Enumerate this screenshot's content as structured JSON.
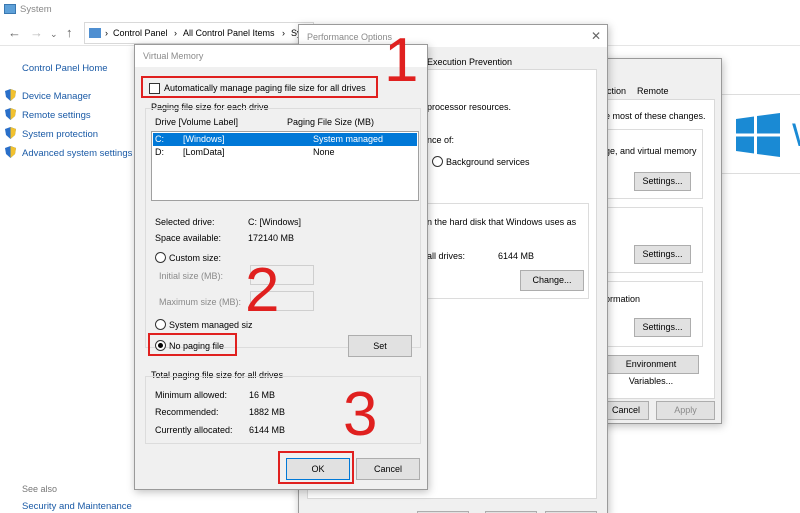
{
  "system_window": {
    "title": "System",
    "breadcrumb": [
      "Control Panel",
      "All Control Panel Items",
      "Sy"
    ],
    "sidebar": {
      "home": "Control Panel Home",
      "items": [
        "Device Manager",
        "Remote settings",
        "System protection",
        "Advanced system settings"
      ],
      "see_also": "See also",
      "security": "Security and Maintenance"
    }
  },
  "performance_options": {
    "title": "Performance Options",
    "tab": "Execution Prevention",
    "text_processor": "processor resources.",
    "text_perf_of": "nce of:",
    "radio_background": "Background services",
    "text_hard_disk": "n the hard disk that Windows uses as",
    "text_all_drives": "all drives:",
    "all_drives_value": "6144 MB",
    "change_button": "Change..."
  },
  "system_properties": {
    "tabs_visible": [
      "ction",
      "Remote"
    ],
    "text_most": "e most of these changes.",
    "text_virtual": "ge, and virtual memory",
    "settings_button": "Settings...",
    "text_formation": "ormation",
    "env_button": "Environment Variables...",
    "cancel_button": "Cancel",
    "apply_button": "Apply"
  },
  "windows_logo_text": "W",
  "virtual_memory": {
    "title": "Virtual Memory",
    "auto_manage_label": "Automatically manage paging file size for all drives",
    "auto_manage_checked": false,
    "group_label": "Paging file size for each drive",
    "columns": [
      "Drive  [Volume Label]",
      "Paging File Size (MB)"
    ],
    "drives": [
      {
        "drive": "C:",
        "label": "[Windows]",
        "size": "System managed",
        "selected": true
      },
      {
        "drive": "D:",
        "label": "[LomData]",
        "size": "None",
        "selected": false
      }
    ],
    "selected_drive_label": "Selected drive:",
    "selected_drive_value": "C:  [Windows]",
    "space_available_label": "Space available:",
    "space_available_value": "172140 MB",
    "custom_size_label": "Custom size:",
    "initial_size_label": "Initial size (MB):",
    "maximum_size_label": "Maximum size (MB):",
    "system_managed_label": "System managed siz",
    "no_paging_label": "No paging file",
    "set_button": "Set",
    "total_group_label": "Total paging file size for all drives",
    "minimum_label": "Minimum allowed:",
    "minimum_value": "16 MB",
    "recommended_label": "Recommended:",
    "recommended_value": "1882 MB",
    "allocated_label": "Currently allocated:",
    "allocated_value": "6144 MB",
    "ok_button": "OK",
    "cancel_button": "Cancel"
  },
  "annotations": [
    "1",
    "2",
    "3"
  ],
  "colors": {
    "annotation_red": "#e0201f",
    "selection_blue": "#0078d7",
    "link_blue": "#1a5aa6"
  }
}
